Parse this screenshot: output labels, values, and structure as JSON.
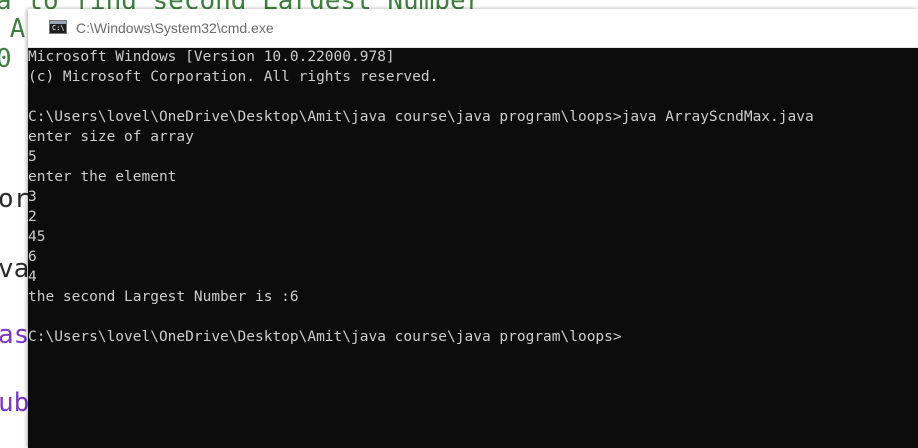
{
  "background_editor": {
    "fragments": [
      {
        "name": "editor-fragment-1",
        "text": "a to find second Largest Number",
        "color": "green"
      },
      {
        "name": "editor-fragment-2",
        "text": " A",
        "color": "green"
      },
      {
        "name": "editor-fragment-3",
        "text": "0",
        "color": "green"
      },
      {
        "name": "editor-fragment-4",
        "text": "or",
        "color": "dark"
      },
      {
        "name": "editor-fragment-5",
        "text": "va",
        "color": "dark"
      },
      {
        "name": "editor-fragment-6",
        "text": "as",
        "color": "purple"
      },
      {
        "name": "editor-fragment-7",
        "text": "ub",
        "color": "purple"
      }
    ]
  },
  "window": {
    "title": "C:\\Windows\\System32\\cmd.exe",
    "icon": "cmd-icon",
    "icon_glyph": "C:\\"
  },
  "console": {
    "lines": [
      "Microsoft Windows [Version 10.0.22000.978]",
      "(c) Microsoft Corporation. All rights reserved.",
      "",
      "C:\\Users\\lovel\\OneDrive\\Desktop\\Amit\\java course\\java program\\loops>java ArrayScndMax.java",
      "enter size of array",
      "5",
      "enter the element",
      "3",
      "2",
      "45",
      "6",
      "4",
      "the second Largest Number is :6",
      "",
      "C:\\Users\\lovel\\OneDrive\\Desktop\\Amit\\java course\\java program\\loops>"
    ]
  },
  "colors": {
    "console_background": "#0c0c0c",
    "console_text": "#cccccc",
    "titlebar": "#ffffff",
    "title_text": "#6b6b6b"
  }
}
